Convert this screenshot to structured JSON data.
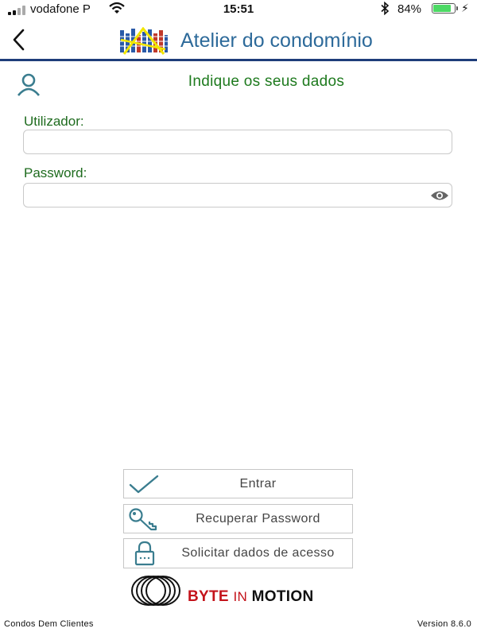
{
  "status_bar": {
    "carrier": "vodafone P",
    "time": "15:51",
    "battery_percent": "84%",
    "battery_level": 0.84,
    "battery_color": "#4cd964"
  },
  "header": {
    "back_icon": "chevron-left-icon",
    "title": "Atelier do condomínio",
    "rule_color": "#1f3d7a"
  },
  "login": {
    "user_icon": "user-icon",
    "title": "Indique os seus dados",
    "username_label": "Utilizador:",
    "username_value": "",
    "password_label": "Password:",
    "password_value": "",
    "show_password_icon": "eye-icon",
    "label_color": "#1e6b1e"
  },
  "actions": {
    "login": {
      "label": "Entrar",
      "icon": "checkmark-icon"
    },
    "recover": {
      "label": "Recuperar Password",
      "icon": "key-icon"
    },
    "request": {
      "label": "Solicitar dados de acesso",
      "icon": "lock-icon"
    }
  },
  "footer": {
    "brand_word1": "BYTE",
    "brand_word2": "IN",
    "brand_word3": "MOTION",
    "brand_color": "#c4131b",
    "left_text": "Condos Dem Clientes",
    "version": "Version 8.6.0"
  }
}
